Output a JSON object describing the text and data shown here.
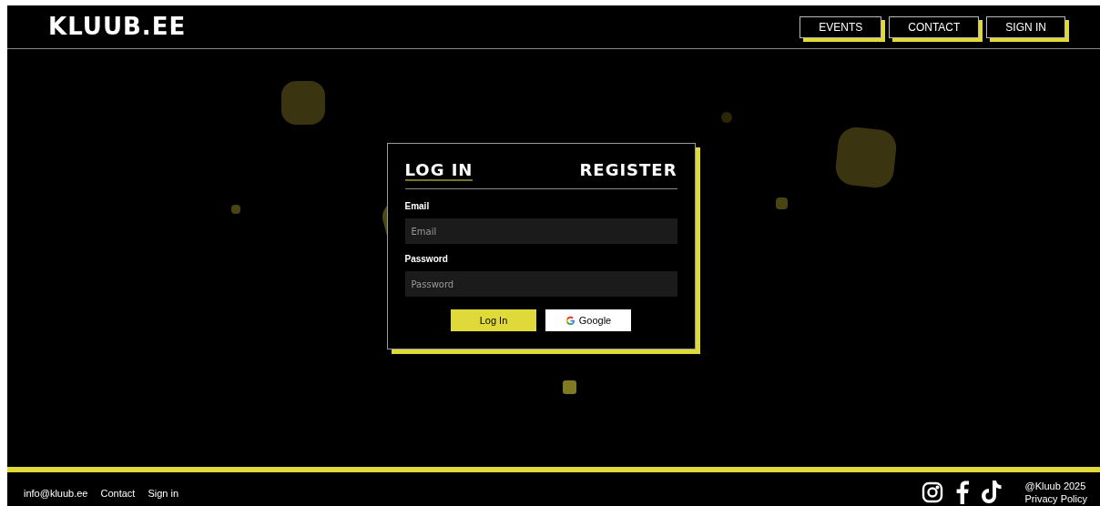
{
  "header": {
    "logo": "KLUUB.EE",
    "nav": [
      "EVENTS",
      "CONTACT",
      "SIGN IN"
    ]
  },
  "auth_card": {
    "tabs": [
      {
        "label": "LOG IN",
        "selected": true
      },
      {
        "label": "REGISTER",
        "selected": false
      }
    ],
    "fields": [
      {
        "label": "Email",
        "placeholder": "Email"
      },
      {
        "label": "Password",
        "placeholder": "Password"
      }
    ],
    "buttons": [
      {
        "kind": "primary",
        "label": "Log In"
      },
      {
        "kind": "google",
        "label": "Google"
      }
    ]
  },
  "footer": {
    "links": [
      "info@kluub.ee",
      "Contact",
      "Sign in"
    ],
    "copyright": "@Kluub 2025",
    "privacy": "Privacy Policy"
  }
}
